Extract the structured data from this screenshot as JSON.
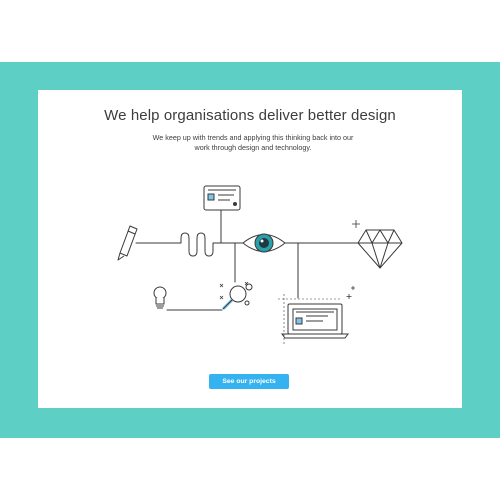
{
  "hero": {
    "headline": "We help organisations deliver better design",
    "subtext_line1": "We keep up with trends and applying this thinking back into our",
    "subtext_line2": "work through design and technology.",
    "cta_label": "See our projects"
  },
  "illustration": {
    "icons": [
      "pencil-icon",
      "browser-card-icon",
      "eye-icon",
      "diamond-icon",
      "lightbulb-icon",
      "magnifier-icon",
      "laptop-icon",
      "sparkle-icon"
    ]
  },
  "colors": {
    "teal_band": "#5ecfc4",
    "card": "#ffffff",
    "text": "#3d3d3d",
    "cta": "#35b3f0",
    "line_art": "#3a3a3a",
    "accent_blue": "#7fc4f0"
  }
}
